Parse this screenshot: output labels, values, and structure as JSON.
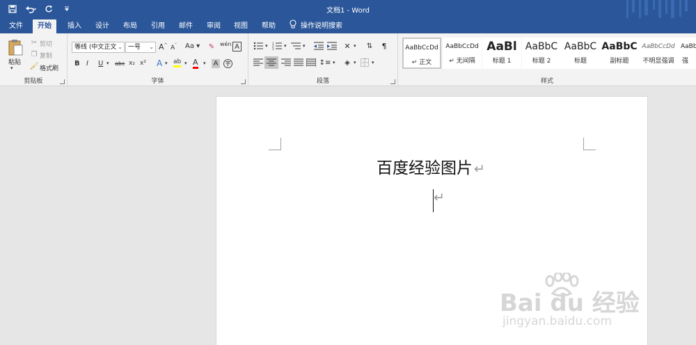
{
  "titlebar": {
    "document_title": "文档1  -  Word",
    "save_icon": "save-icon",
    "undo_icon": "undo-icon",
    "redo_icon": "redo-icon",
    "customize_icon": "customize-qat-icon"
  },
  "tabs": [
    {
      "label": "文件"
    },
    {
      "label": "开始"
    },
    {
      "label": "插入"
    },
    {
      "label": "设计"
    },
    {
      "label": "布局"
    },
    {
      "label": "引用"
    },
    {
      "label": "邮件"
    },
    {
      "label": "审阅"
    },
    {
      "label": "视图"
    },
    {
      "label": "帮助"
    },
    {
      "label": "操作说明搜索"
    }
  ],
  "clipboard": {
    "group_label": "剪贴板",
    "paste": "粘贴",
    "cut": "剪切",
    "copy": "复制",
    "format_painter": "格式刷"
  },
  "font": {
    "group_label": "字体",
    "font_name": "等线 (中文正文",
    "font_size": "一号",
    "grow": "A",
    "shrink": "A",
    "case": "Aa",
    "phonetic": "wén",
    "border_char": "A",
    "bold": "B",
    "italic": "I",
    "underline": "U",
    "strike": "abc",
    "subscript": "x₂",
    "superscript": "x²",
    "effects": "A",
    "highlight": "ab",
    "font_color": "A",
    "shading": "A",
    "enclose": "字"
  },
  "paragraph": {
    "group_label": "段落"
  },
  "styles": {
    "group_label": "样式",
    "items": [
      {
        "preview": "AaBbCcDd",
        "name": "↵ 正文"
      },
      {
        "preview": "AaBbCcDd",
        "name": "↵ 无间隔"
      },
      {
        "preview": "AaBl",
        "name": "标题 1"
      },
      {
        "preview": "AaBbC",
        "name": "标题 2"
      },
      {
        "preview": "AaBbC",
        "name": "标题"
      },
      {
        "preview": "AaBbC",
        "name": "副标题"
      },
      {
        "preview": "AaBbCcDd",
        "name": "不明显强调"
      },
      {
        "preview": "AaBb",
        "name": "强"
      }
    ]
  },
  "document": {
    "heading": "百度经验图片",
    "paragraph_mark": "↵"
  },
  "watermark": {
    "brand": "Bai du 经验",
    "url": "jingyan.baidu.com"
  },
  "colors": {
    "titlebar": "#2b579a",
    "ribbon": "#f3f3f3",
    "canvas": "#e6e6e6",
    "highlight_yellow": "#ffff00",
    "font_red": "#ff0000"
  }
}
